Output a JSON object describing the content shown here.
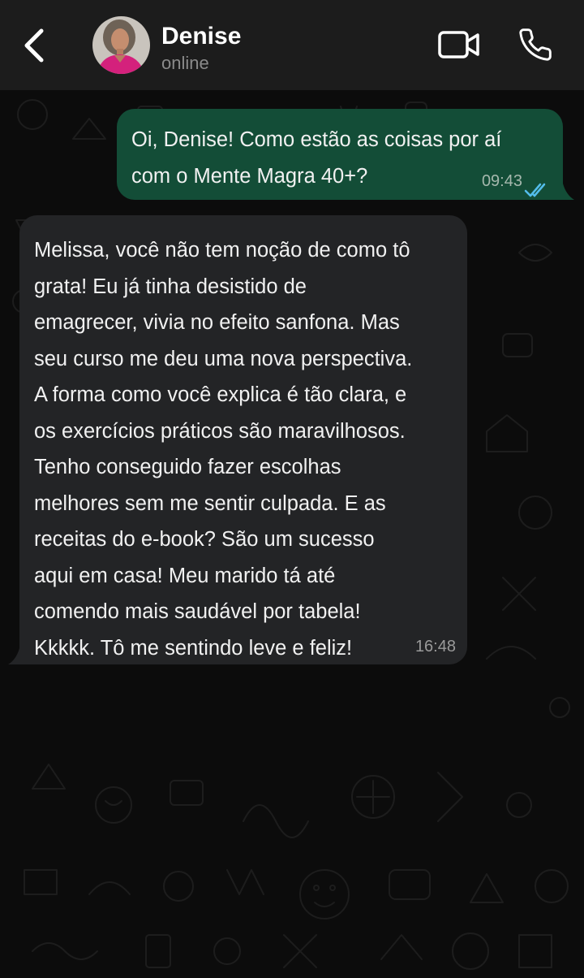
{
  "contact": {
    "name": "Denise",
    "status": "online"
  },
  "messages": [
    {
      "direction": "outgoing",
      "text": "Oi, Denise! Como estão as coisas por aí\ncom o Mente Magra 40+?",
      "time": "09:43",
      "read": true
    },
    {
      "direction": "incoming",
      "text": "Melissa, você não tem noção de como tô\ngrata! Eu já tinha desistido de\nemagrecer, vivia no efeito sanfona. Mas\nseu curso me deu uma nova perspectiva.\nA forma como você explica é tão clara, e\nos exercícios práticos são maravilhosos.\nTenho conseguido fazer escolhas\nmelhores sem me sentir culpada. E as\nreceitas do e-book? São um sucesso\naqui em casa! Meu marido tá até\ncomendo mais saudável por tabela!\nKkkkk. Tô me sentindo leve e feliz!",
      "time": "16:48"
    }
  ],
  "icons": {
    "back": "chevron-left-icon",
    "video": "video-camera-icon",
    "call": "phone-icon",
    "read_receipt": "double-check-icon"
  },
  "colors": {
    "header_bg": "#1c1c1c",
    "chat_bg": "#0c0c0c",
    "outgoing_bubble": "#134d37",
    "incoming_bubble": "#232426",
    "read_tick": "#53bdeb",
    "status_text": "#8a8a8a"
  }
}
